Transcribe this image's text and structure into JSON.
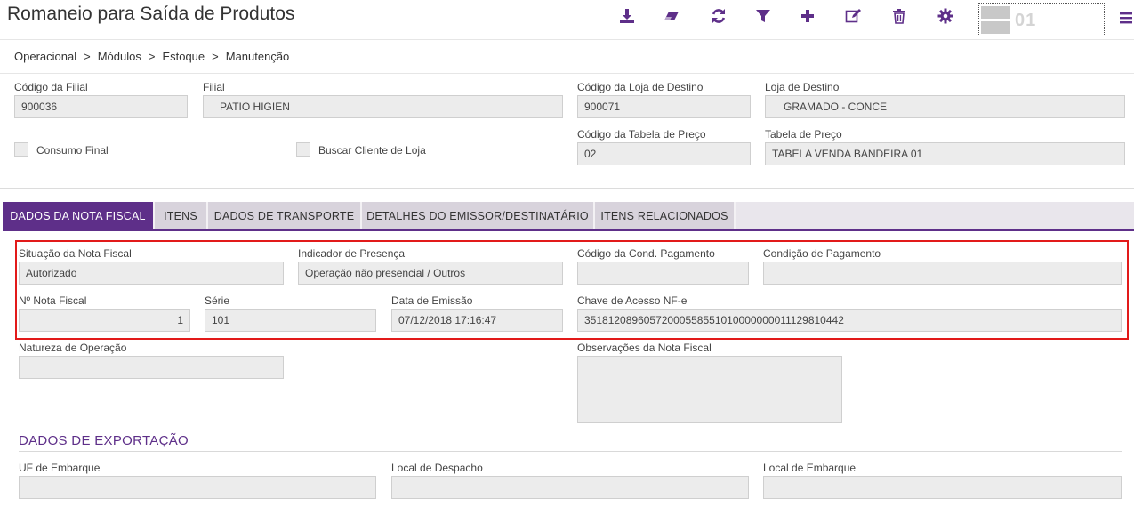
{
  "header": {
    "title": "Romaneio para Saída de Produtos",
    "logo_number": "01"
  },
  "toolbar": {
    "icons": [
      "download-icon",
      "eraser-icon",
      "refresh-icon",
      "filter-icon",
      "add-icon",
      "edit-icon",
      "delete-icon",
      "settings-icon"
    ],
    "accent_color": "#5e2f89"
  },
  "breadcrumb": {
    "items": [
      "Operacional",
      "Módulos",
      "Estoque",
      "Manutenção"
    ],
    "separator": ">"
  },
  "top_form": {
    "codigo_filial": {
      "label": "Código da Filial",
      "value": "900036"
    },
    "filial": {
      "label": "Filial",
      "value": "PATIO HIGIEN"
    },
    "codigo_loja_destino": {
      "label": "Código da Loja de Destino",
      "value": "900071"
    },
    "loja_destino": {
      "label": "Loja de Destino",
      "value": "GRAMADO - CONCE"
    },
    "consumo_final": {
      "label": "Consumo Final"
    },
    "buscar_cliente": {
      "label": "Buscar Cliente de Loja"
    },
    "codigo_tabela_preco": {
      "label": "Código da Tabela de Preço",
      "value": "02"
    },
    "tabela_preco": {
      "label": "Tabela de Preço",
      "value": "TABELA VENDA BANDEIRA 01"
    }
  },
  "tabs": [
    {
      "label": "DADOS DA NOTA FISCAL",
      "active": true
    },
    {
      "label": "ITENS",
      "active": false
    },
    {
      "label": "DADOS DE TRANSPORTE",
      "active": false
    },
    {
      "label": "DETALHES DO EMISSOR/DESTINATÁRIO",
      "active": false
    },
    {
      "label": "ITENS RELACIONADOS",
      "active": false
    }
  ],
  "nota_fiscal": {
    "situacao": {
      "label": "Situação da Nota Fiscal",
      "value": "Autorizado"
    },
    "indicador_presenca": {
      "label": "Indicador de Presença",
      "value": "Operação não presencial / Outros"
    },
    "codigo_cond_pagamento": {
      "label": "Código da Cond. Pagamento",
      "value": ""
    },
    "condicao_pagamento": {
      "label": "Condição de Pagamento",
      "value": ""
    },
    "numero_nota": {
      "label": "Nº Nota Fiscal",
      "value": "1"
    },
    "serie": {
      "label": "Série",
      "value": "101"
    },
    "data_emissao": {
      "label": "Data de Emissão",
      "value": "07/12/2018 17:16:47"
    },
    "chave_acesso": {
      "label": "Chave de Acesso NF-e",
      "value": "35181208960572000558551010000000011129810442"
    },
    "natureza_operacao": {
      "label": "Natureza de Operação",
      "value": ""
    },
    "observacoes": {
      "label": "Observações da Nota Fiscal",
      "value": ""
    }
  },
  "exportacao": {
    "title": "DADOS DE EXPORTAÇÃO",
    "uf_embarque": {
      "label": "UF de Embarque",
      "value": ""
    },
    "local_despacho": {
      "label": "Local de Despacho",
      "value": ""
    },
    "local_embarque": {
      "label": "Local de Embarque",
      "value": ""
    }
  }
}
